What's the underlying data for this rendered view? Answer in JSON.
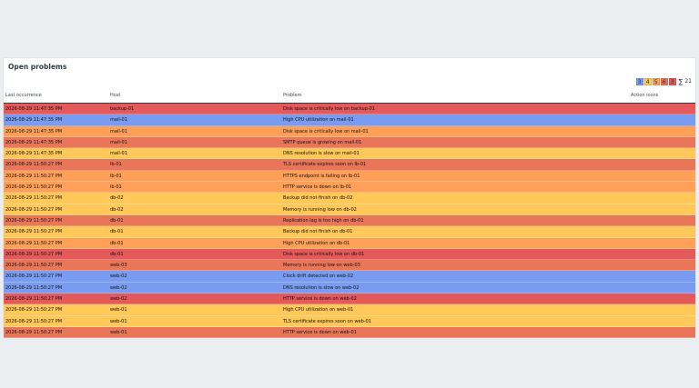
{
  "widget": {
    "title": "Open problems"
  },
  "severity_summary": {
    "chips": [
      {
        "label": "3",
        "color": "#7a9cf0"
      },
      {
        "label": "4",
        "color": "#ffc859"
      },
      {
        "label": "5",
        "color": "#ffa059"
      },
      {
        "label": "6",
        "color": "#e97659"
      },
      {
        "label": "3",
        "color": "#e45959"
      }
    ],
    "sigma": "∑",
    "total": "21"
  },
  "columns": {
    "time": "Last occurrence",
    "host": "Host",
    "problem": "Problem",
    "actions": "Action icons"
  },
  "severity_colors": {
    "information": "#7a9cf0",
    "warning": "#ffc859",
    "average": "#ffa059",
    "high": "#e97659",
    "disaster": "#e45959"
  },
  "rows": [
    {
      "time": "2026-08-29 11:47:35 PM",
      "host": "backup-01",
      "problem": "Disk space is critically low on backup-01",
      "severity": "disaster"
    },
    {
      "time": "2026-08-29 11:47:35 PM",
      "host": "mail-01",
      "problem": "High CPU utilization on mail-01",
      "severity": "information"
    },
    {
      "time": "2026-08-29 11:47:35 PM",
      "host": "mail-01",
      "problem": "Disk space is critically low on mail-01",
      "severity": "average"
    },
    {
      "time": "2026-08-29 11:47:35 PM",
      "host": "mail-01",
      "problem": "SMTP queue is growing on mail-01",
      "severity": "high"
    },
    {
      "time": "2026-08-29 11:47:35 PM",
      "host": "mail-01",
      "problem": "DNS resolution is slow on mail-01",
      "severity": "warning"
    },
    {
      "time": "2026-08-29 11:50:27 PM",
      "host": "lb-01",
      "problem": "TLS certificate expires soon on lb-01",
      "severity": "high"
    },
    {
      "time": "2026-08-29 11:50:27 PM",
      "host": "lb-01",
      "problem": "HTTPS endpoint is failing on lb-01",
      "severity": "average"
    },
    {
      "time": "2026-08-29 11:50:27 PM",
      "host": "lb-01",
      "problem": "HTTP service is down on lb-01",
      "severity": "average"
    },
    {
      "time": "2026-08-29 11:50:27 PM",
      "host": "db-02",
      "problem": "Backup did not finish on db-02",
      "severity": "warning"
    },
    {
      "time": "2026-08-29 11:50:27 PM",
      "host": "db-02",
      "problem": "Memory is running low on db-02",
      "severity": "warning"
    },
    {
      "time": "2026-08-29 11:50:27 PM",
      "host": "db-01",
      "problem": "Replication lag is too high on db-01",
      "severity": "high"
    },
    {
      "time": "2026-08-29 11:50:27 PM",
      "host": "db-01",
      "problem": "Backup did not finish on db-01",
      "severity": "warning"
    },
    {
      "time": "2026-08-29 11:50:27 PM",
      "host": "db-01",
      "problem": "High CPU utilization on db-01",
      "severity": "average"
    },
    {
      "time": "2026-08-29 11:50:27 PM",
      "host": "db-01",
      "problem": "Disk space is critically low on db-01",
      "severity": "disaster"
    },
    {
      "time": "2026-08-29 11:50:27 PM",
      "host": "web-03",
      "problem": "Memory is running low on web-03",
      "severity": "high"
    },
    {
      "time": "2026-08-29 11:50:27 PM",
      "host": "web-02",
      "problem": "Clock drift detected on web-02",
      "severity": "information"
    },
    {
      "time": "2026-08-29 11:50:27 PM",
      "host": "web-02",
      "problem": "DNS resolution is slow on web-02",
      "severity": "information"
    },
    {
      "time": "2026-08-29 11:50:27 PM",
      "host": "web-02",
      "problem": "HTTP service is down on web-02",
      "severity": "disaster"
    },
    {
      "time": "2026-08-29 11:50:27 PM",
      "host": "web-01",
      "problem": "High CPU utilization on web-01",
      "severity": "warning"
    },
    {
      "time": "2026-08-29 11:50:27 PM",
      "host": "web-01",
      "problem": "TLS certificate expires soon on web-01",
      "severity": "warning"
    },
    {
      "time": "2026-08-29 11:50:27 PM",
      "host": "web-01",
      "problem": "HTTP service is down on web-01",
      "severity": "high"
    }
  ]
}
